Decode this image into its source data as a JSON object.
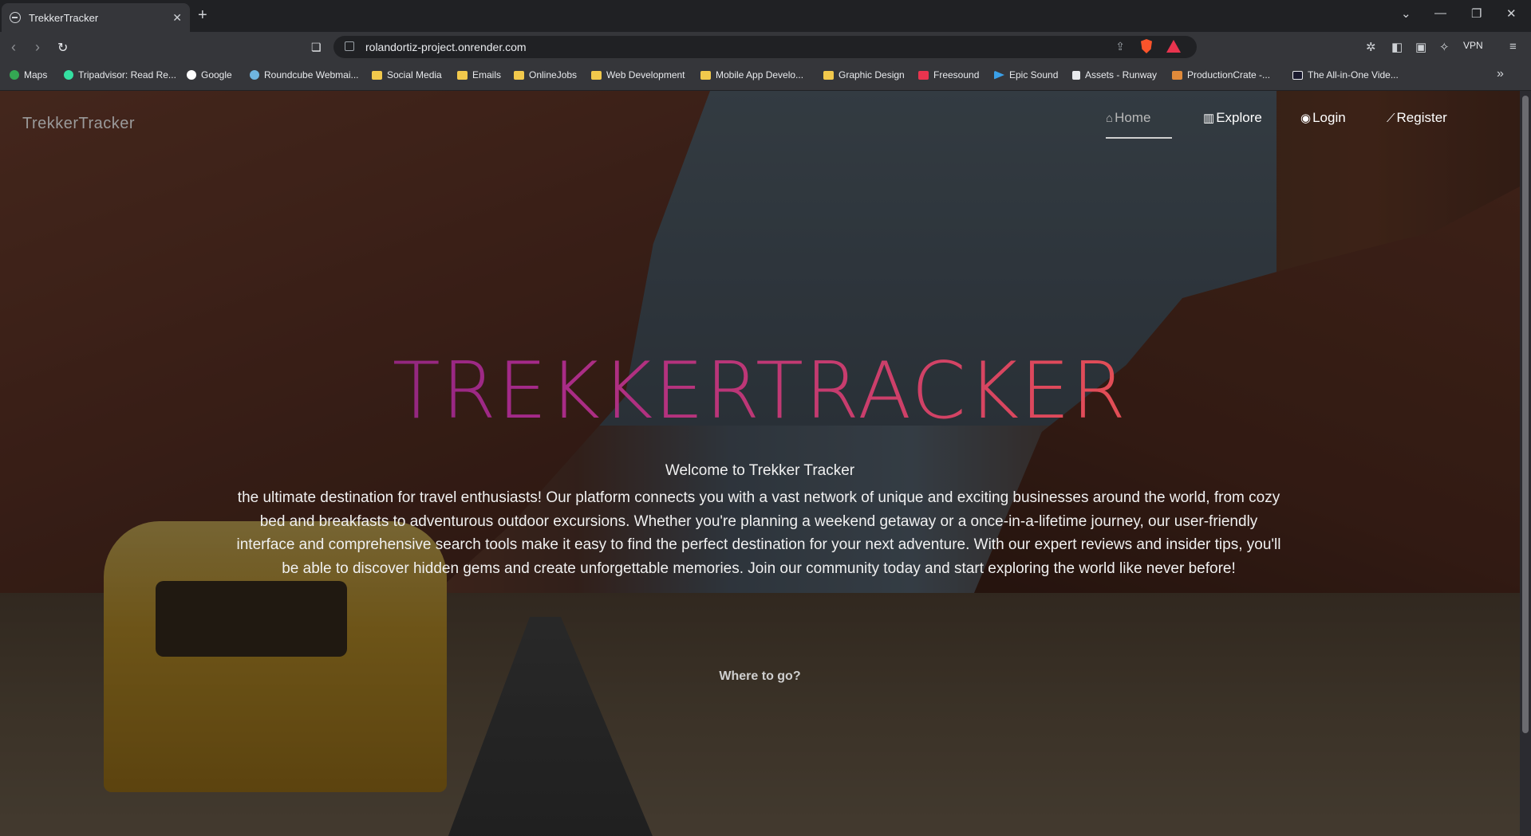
{
  "browser": {
    "tab": {
      "title": "TrekkerTracker",
      "close": "✕"
    },
    "new_tab": "+",
    "url": "rolandortiz-project.onrender.com",
    "vpn_label": "VPN",
    "window_controls": [
      "⌄",
      "—",
      "❐",
      "✕"
    ]
  },
  "bookmarks": [
    {
      "label": "Maps",
      "icon": "map-pin-icon",
      "color": "#34a853"
    },
    {
      "label": "Tripadvisor: Read Re...",
      "icon": "tripadvisor-icon",
      "color": "#34e0a1"
    },
    {
      "label": "Google",
      "icon": "google-icon",
      "color": "#ffffff"
    },
    {
      "label": "Roundcube Webmai...",
      "icon": "roundcube-icon",
      "color": "#6fb5e0"
    },
    {
      "label": "Social Media",
      "icon": "folder-icon",
      "color": "#f2c94c"
    },
    {
      "label": "Emails",
      "icon": "folder-icon",
      "color": "#f2c94c"
    },
    {
      "label": "OnlineJobs",
      "icon": "folder-icon",
      "color": "#f2c94c"
    },
    {
      "label": "Web Development",
      "icon": "folder-icon",
      "color": "#f2c94c"
    },
    {
      "label": "Mobile App Develo...",
      "icon": "folder-icon",
      "color": "#f2c94c"
    },
    {
      "label": "Graphic Design",
      "icon": "folder-icon",
      "color": "#f2c94c"
    },
    {
      "label": "Freesound",
      "icon": "freesound-icon",
      "color": "#e8344e"
    },
    {
      "label": "Epic Sound",
      "icon": "play-icon",
      "color": "#3aa0e8"
    },
    {
      "label": "Assets - Runway",
      "icon": "runway-icon",
      "color": "#e8eaed"
    },
    {
      "label": "ProductionCrate -...",
      "icon": "productioncrate-icon",
      "color": "#e08a3a"
    },
    {
      "label": "The All-in-One Vide...",
      "icon": "video-icon",
      "color": "#e8eaed"
    }
  ],
  "site": {
    "brand": "TrekkerTracker",
    "nav": [
      {
        "label": "Home",
        "icon": "home-icon",
        "glyph": "⌂",
        "active": true
      },
      {
        "label": "Explore",
        "icon": "map-icon",
        "glyph": "▥",
        "active": false
      },
      {
        "label": "Login",
        "icon": "user-circle-icon",
        "glyph": "◉",
        "active": false
      },
      {
        "label": "Register",
        "icon": "pencil-icon",
        "glyph": "⟋",
        "active": false
      }
    ],
    "hero_title": "TREKKERTRACKER",
    "welcome": "Welcome to Trekker Tracker",
    "description": "the ultimate destination for travel enthusiasts! Our platform connects you with a vast network of unique and exciting businesses around the world, from cozy bed and breakfasts to adventurous outdoor excursions. Whether you're planning a weekend getaway or a once-in-a-lifetime journey, our user-friendly interface and comprehensive search tools make it easy to find the perfect destination for your next adventure. With our expert reviews and insider tips, you'll be able to discover hidden gems and create unforgettable memories. Join our community today and start exploring the world like never before!",
    "where_to_go": "Where to go?"
  },
  "colors": {
    "hero_gradient": [
      "#5a1f5e",
      "#a52a8a",
      "#e04a5a",
      "#f06a3a"
    ],
    "browser_bg": "#35363a"
  }
}
